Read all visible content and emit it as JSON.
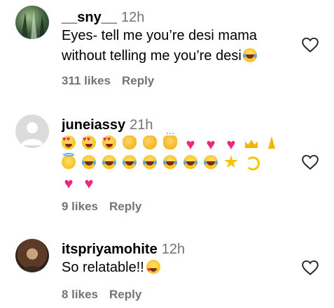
{
  "comments": [
    {
      "username": "__sny__",
      "time": "12h",
      "text_lines": [
        "Eyes- tell me you’re desi mama",
        "without telling me you’re desi"
      ],
      "likes": "311 likes",
      "reply": "Reply"
    },
    {
      "username": "juneiassy",
      "time": "21h",
      "emoji_rows": [
        [
          "heart-eyes",
          "heart-eyes",
          "heart-eyes",
          "clap",
          "clap",
          "raising-hands",
          "pink-heart",
          "pink-heart",
          "pink-heart",
          "crown",
          "pray"
        ],
        [
          "halo",
          "laugh",
          "laugh",
          "laugh",
          "laugh",
          "laugh",
          "laugh",
          "laugh",
          "star",
          "dizzy"
        ],
        [
          "pink-heart",
          "pink-heart"
        ]
      ],
      "likes": "9 likes",
      "reply": "Reply"
    },
    {
      "username": "itspriyamohite",
      "time": "12h",
      "text": "So relatable!!",
      "likes": "8 likes",
      "reply": "Reply"
    }
  ]
}
